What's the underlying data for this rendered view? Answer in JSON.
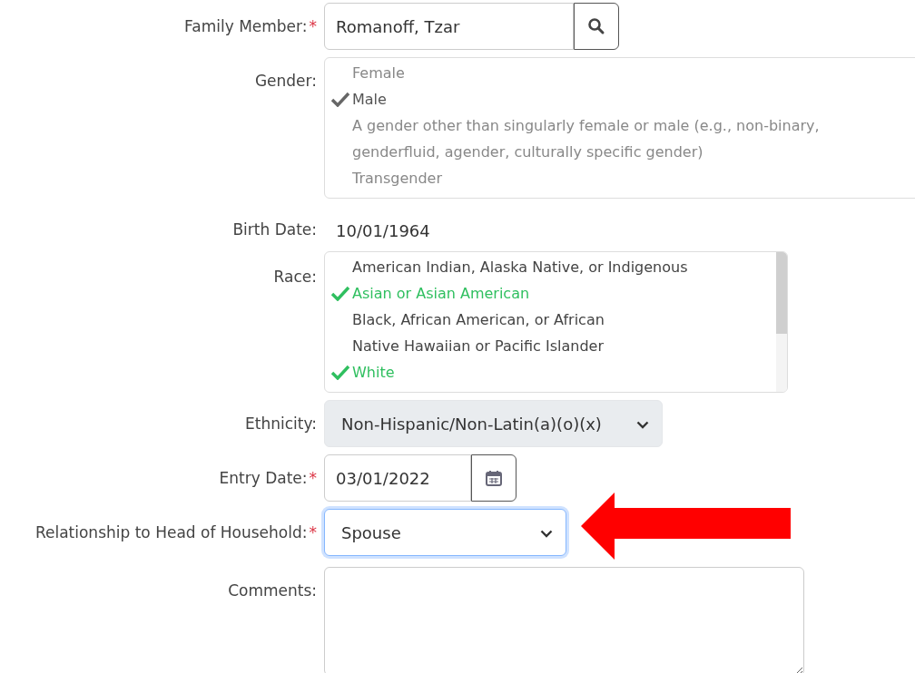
{
  "fields": [
    {
      "kind": "lookup",
      "label": "Family Member:",
      "required_mark": "*",
      "value": "Romanoff, Tzar"
    },
    {
      "kind": "checklist",
      "label": "Gender:",
      "disabled": true,
      "scrollbar": false,
      "options": [
        {
          "label": "Female",
          "selected": false
        },
        {
          "label": "Male",
          "selected": true
        },
        {
          "label": "A gender other than singularly female or male (e.g., non-binary, genderfluid, agender, culturally specific gender)",
          "selected": false
        },
        {
          "label": "Transgender",
          "selected": false
        }
      ]
    },
    {
      "kind": "static",
      "label": "Birth Date:",
      "value": "10/01/1964"
    },
    {
      "kind": "checklist",
      "label": "Race:",
      "disabled": false,
      "scrollbar": true,
      "options": [
        {
          "label": "American Indian, Alaska Native, or Indigenous",
          "selected": false
        },
        {
          "label": "Asian or Asian American",
          "selected": true
        },
        {
          "label": "Black, African American, or African",
          "selected": false
        },
        {
          "label": "Native Hawaiian or Pacific Islander",
          "selected": false
        },
        {
          "label": "White",
          "selected": true
        }
      ]
    },
    {
      "kind": "select",
      "label": "Ethnicity:",
      "disabled": true,
      "focused": false,
      "value": "Non-Hispanic/Non-Latin(a)(o)(x)"
    },
    {
      "kind": "date",
      "label": "Entry Date:",
      "required_mark": "*",
      "value": "03/01/2022"
    },
    {
      "kind": "select",
      "label": "Relationship to Head of Household:",
      "required_mark": "*",
      "disabled": false,
      "focused": true,
      "value": "Spouse",
      "pointer": true
    },
    {
      "kind": "textarea",
      "label": "Comments:"
    }
  ]
}
